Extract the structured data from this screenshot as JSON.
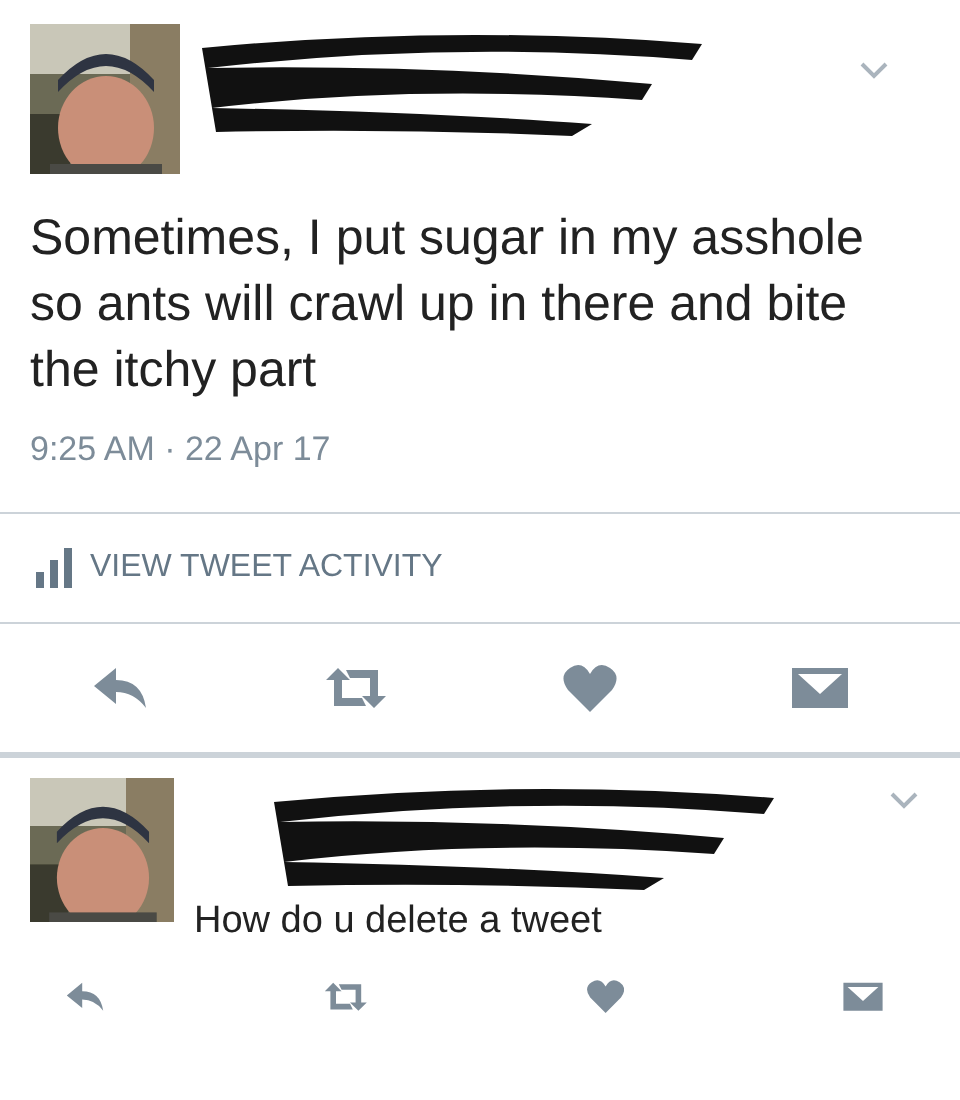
{
  "tweets": [
    {
      "kind": "detail",
      "text": "Sometimes, I put sugar in my asshole so ants will crawl up in there and bite the itchy part",
      "time": "9:25 AM · 22 Apr 17",
      "activity": "VIEW TWEET ACTIVITY"
    },
    {
      "kind": "reply",
      "text": "How do u delete a tweet"
    }
  ]
}
